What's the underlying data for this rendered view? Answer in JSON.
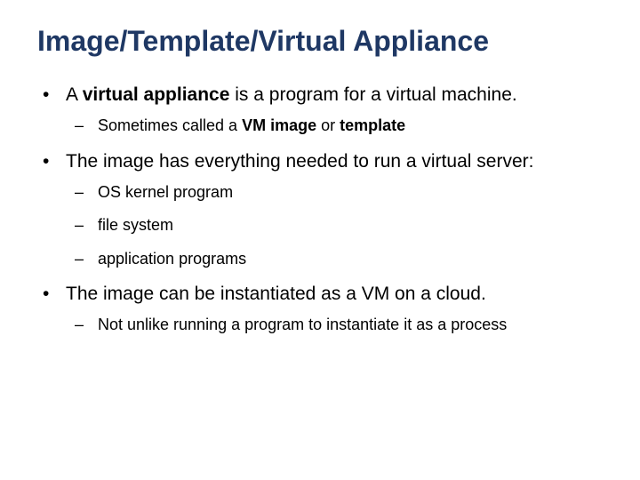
{
  "title": "Image/Template/Virtual Appliance",
  "bullets": {
    "b1_pre": "A ",
    "b1_bold": "virtual appliance",
    "b1_post": " is a program for a virtual machine.",
    "b1_sub1_pre": "Sometimes called a ",
    "b1_sub1_bold1": "VM image",
    "b1_sub1_mid": " or ",
    "b1_sub1_bold2": "template",
    "b2": "The image has everything needed to run a virtual server:",
    "b2_sub1": "OS kernel program",
    "b2_sub2": "file system",
    "b2_sub3": "application programs",
    "b3": "The image can be instantiated as a VM on a cloud.",
    "b3_sub1": "Not unlike running a program to instantiate it as a process"
  },
  "bullet_char_l1": "•",
  "bullet_char_l2": "–"
}
